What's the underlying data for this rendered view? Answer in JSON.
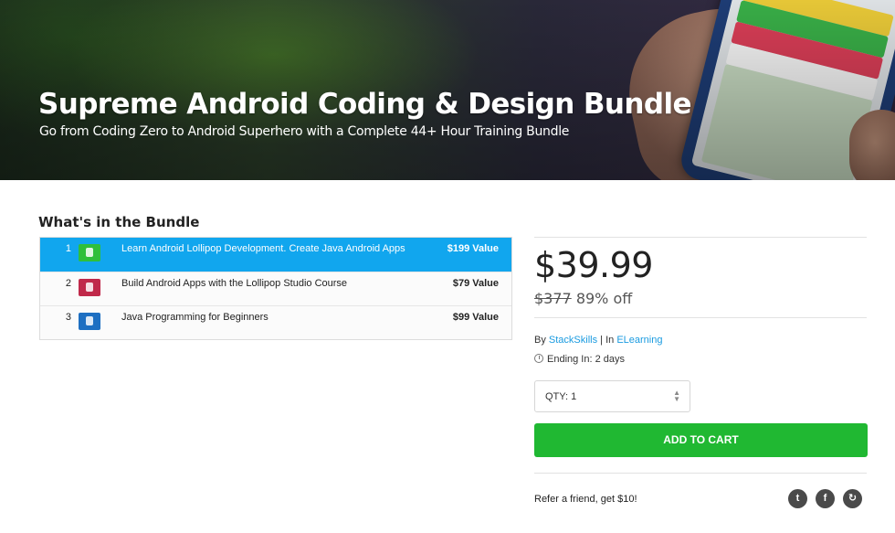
{
  "hero": {
    "title": "Supreme Android Coding & Design Bundle",
    "subtitle": "Go from Coding Zero to Android Superhero with a Complete 44+ Hour Training Bundle"
  },
  "bundle": {
    "heading": "What's in the Bundle",
    "items": [
      {
        "num": "1",
        "title": "Learn Android Lollipop Development. Create Java Android Apps",
        "value": "$199 Value",
        "thumb_color": "#2fbf3a",
        "active": true
      },
      {
        "num": "2",
        "title": "Build Android Apps with the Lollipop Studio Course",
        "value": "$79 Value",
        "thumb_color": "#c0294a",
        "active": false
      },
      {
        "num": "3",
        "title": "Java Programming for Beginners",
        "value": "$99 Value",
        "thumb_color": "#1d6fc2",
        "active": false
      }
    ]
  },
  "purchase": {
    "price": "$39.99",
    "original_price": "$377",
    "discount": "89% off",
    "by_label": "By",
    "vendor": "StackSkills",
    "separator": "|",
    "in_label": "In",
    "category": "ELearning",
    "ending": "Ending In: 2 days",
    "qty_label": "QTY: 1",
    "add_to_cart": "ADD TO CART",
    "refer": "Refer a friend, get $10!"
  },
  "social": [
    {
      "name": "twitter-icon",
      "glyph": "t"
    },
    {
      "name": "facebook-icon",
      "glyph": "f"
    },
    {
      "name": "share-icon",
      "glyph": "↻"
    }
  ],
  "colors": {
    "accent_blue": "#11a6ee",
    "cart_green": "#20b832",
    "link_blue": "#1a9be0"
  }
}
